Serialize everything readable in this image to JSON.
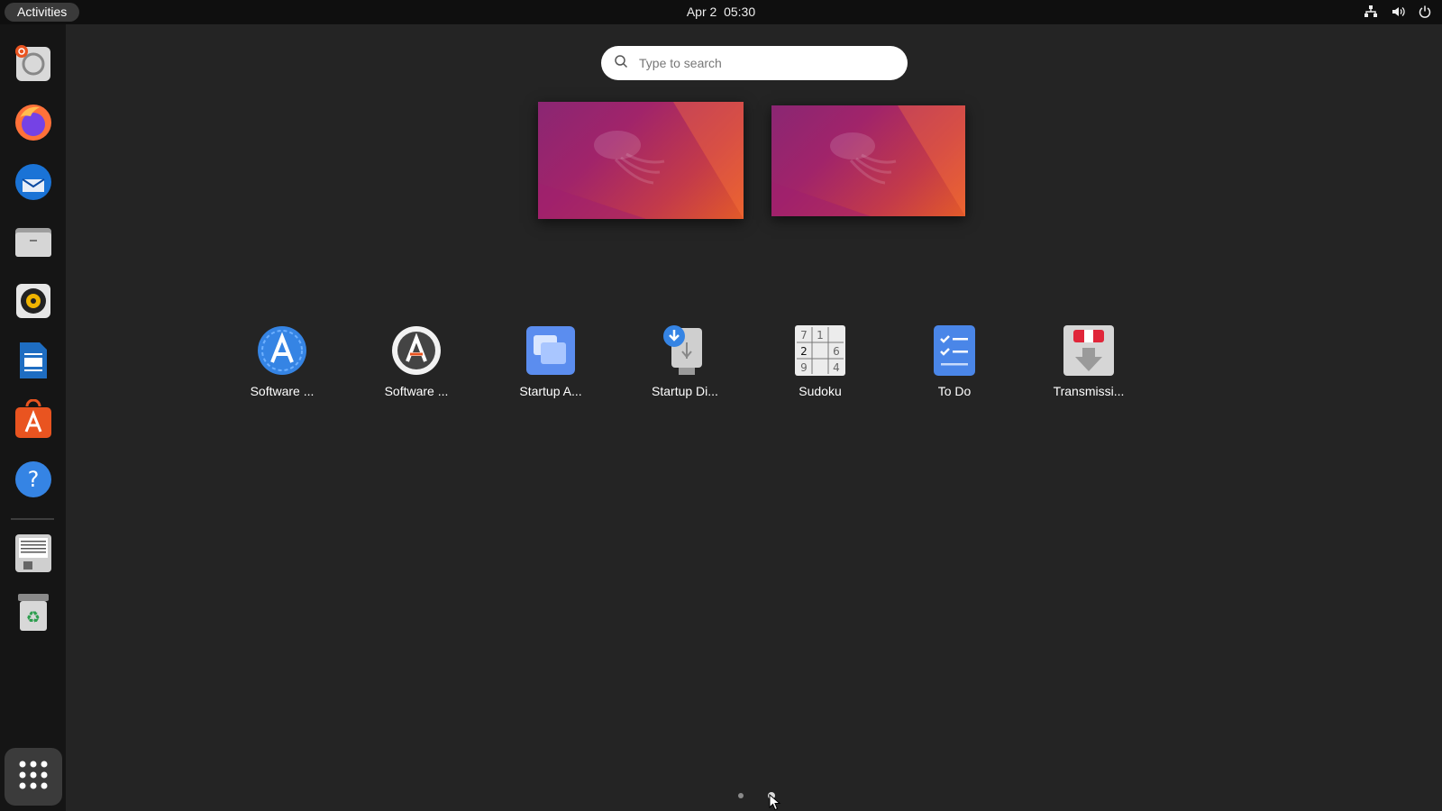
{
  "topbar": {
    "activities_label": "Activities",
    "date": "Apr 2",
    "time": "05:30",
    "tray_icons": [
      "network-icon",
      "volume-icon",
      "power-icon"
    ]
  },
  "dock": {
    "items": [
      {
        "name": "ubuntu-installer",
        "icon": "installer-icon"
      },
      {
        "name": "firefox",
        "icon": "firefox-icon"
      },
      {
        "name": "thunderbird",
        "icon": "thunderbird-icon"
      },
      {
        "name": "files",
        "icon": "files-icon"
      },
      {
        "name": "rhythmbox",
        "icon": "rhythmbox-icon"
      },
      {
        "name": "libreoffice-writer",
        "icon": "writer-icon"
      },
      {
        "name": "ubuntu-software",
        "icon": "software-icon"
      },
      {
        "name": "help",
        "icon": "help-icon"
      },
      {
        "name": "disk-drive",
        "icon": "drive-icon"
      },
      {
        "name": "trash",
        "icon": "trash-icon"
      }
    ],
    "show_apps": "apps-grid-icon"
  },
  "search": {
    "placeholder": "Type to search"
  },
  "apps": [
    {
      "label": "Software ...",
      "icon": "software-updater-icon"
    },
    {
      "label": "Software ...",
      "icon": "software-properties-icon"
    },
    {
      "label": "Startup A...",
      "icon": "startup-applications-icon"
    },
    {
      "label": "Startup Di...",
      "icon": "startup-disk-creator-icon"
    },
    {
      "label": "Sudoku",
      "icon": "sudoku-icon"
    },
    {
      "label": "To Do",
      "icon": "todo-icon"
    },
    {
      "label": "Transmissi...",
      "icon": "transmission-icon"
    }
  ],
  "sudoku_digits": [
    "7",
    "1",
    "2",
    "6",
    "9",
    "4"
  ],
  "colors": {
    "background": "#242424",
    "topbar": "#0f0f0f",
    "dock": "#151515",
    "accent_blue": "#3584e4",
    "ubuntu_orange": "#e95420"
  }
}
